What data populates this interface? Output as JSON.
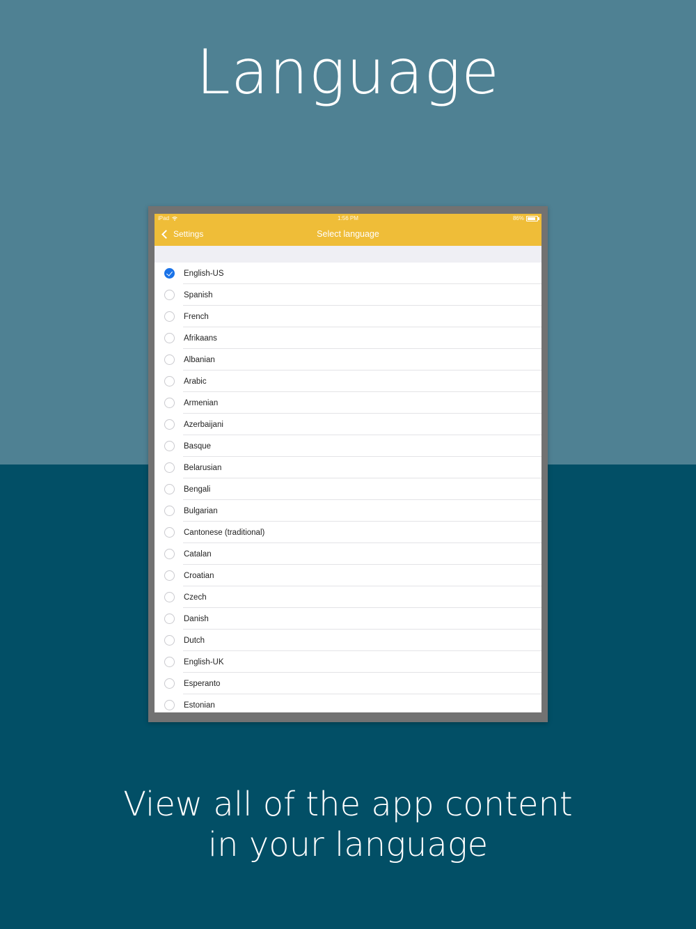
{
  "promo": {
    "headline": "Language",
    "caption_line1": "View all of the app content",
    "caption_line2": "in your language"
  },
  "status_bar": {
    "device": "iPad",
    "time": "1:56 PM",
    "battery": "86%"
  },
  "nav": {
    "back_label": "Settings",
    "title": "Select language"
  },
  "colors": {
    "navbar": "#efbd38",
    "selected": "#1a73e8",
    "bg_top": "#4f8193",
    "bg_bottom": "#024f66"
  },
  "languages": [
    {
      "label": "English-US",
      "selected": true
    },
    {
      "label": "Spanish",
      "selected": false
    },
    {
      "label": "French",
      "selected": false
    },
    {
      "label": "Afrikaans",
      "selected": false
    },
    {
      "label": "Albanian",
      "selected": false
    },
    {
      "label": "Arabic",
      "selected": false
    },
    {
      "label": "Armenian",
      "selected": false
    },
    {
      "label": "Azerbaijani",
      "selected": false
    },
    {
      "label": "Basque",
      "selected": false
    },
    {
      "label": "Belarusian",
      "selected": false
    },
    {
      "label": "Bengali",
      "selected": false
    },
    {
      "label": "Bulgarian",
      "selected": false
    },
    {
      "label": "Cantonese (traditional)",
      "selected": false
    },
    {
      "label": "Catalan",
      "selected": false
    },
    {
      "label": "Croatian",
      "selected": false
    },
    {
      "label": "Czech",
      "selected": false
    },
    {
      "label": "Danish",
      "selected": false
    },
    {
      "label": "Dutch",
      "selected": false
    },
    {
      "label": "English-UK",
      "selected": false
    },
    {
      "label": "Esperanto",
      "selected": false
    },
    {
      "label": "Estonian",
      "selected": false
    }
  ]
}
